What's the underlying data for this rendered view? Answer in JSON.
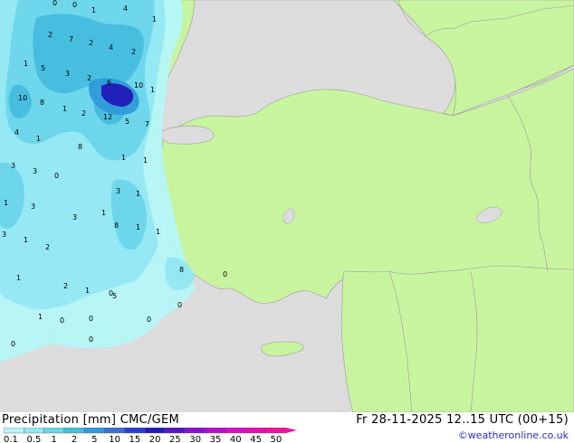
{
  "title": {
    "product": "Precipitation [mm]  CMC/GEM",
    "valid_time": "Fr 28-11-2025 12..15 UTC (00+15)"
  },
  "credit": "©weatheronline.co.uk",
  "legend": {
    "ticks": [
      "0.1",
      "0.5",
      "1",
      "2",
      "5",
      "10",
      "15",
      "20",
      "25",
      "30",
      "35",
      "40",
      "45",
      "50"
    ],
    "colors": [
      "#b5f5f8",
      "#93e8f3",
      "#6cd6ea",
      "#45bde0",
      "#2f9bd8",
      "#3a6fd4",
      "#2a3fd0",
      "#2219b8",
      "#5a12c8",
      "#8a10d0",
      "#b40fcc",
      "#d40fc4",
      "#e30fb0",
      "#f012a0"
    ]
  },
  "map": {
    "colors": {
      "sea": "#dcdcdc",
      "land": "#c8f4a0",
      "border": "#9a9a9a",
      "precip_light": "#b5f5f8",
      "precip_mid": "#93e8f3",
      "precip_heavy": "#6cd6ea",
      "precip_peak": "#2219b8"
    },
    "values": [
      {
        "t": "0"
      },
      {
        "t": "0"
      },
      {
        "t": "1"
      },
      {
        "t": "4"
      },
      {
        "t": "1"
      },
      {
        "t": "2"
      },
      {
        "t": "7"
      },
      {
        "t": "2"
      },
      {
        "t": "4"
      },
      {
        "t": "2"
      },
      {
        "t": "1"
      },
      {
        "t": "5"
      },
      {
        "t": "3"
      },
      {
        "t": "2"
      },
      {
        "t": "6"
      },
      {
        "t": "10"
      },
      {
        "t": "1"
      },
      {
        "t": "10"
      },
      {
        "t": "8"
      },
      {
        "t": "1"
      },
      {
        "t": "2"
      },
      {
        "t": "12"
      },
      {
        "t": "5"
      },
      {
        "t": "7"
      },
      {
        "t": "4"
      },
      {
        "t": "1"
      },
      {
        "t": "8"
      },
      {
        "t": "1"
      },
      {
        "t": "1"
      },
      {
        "t": "3"
      },
      {
        "t": "0"
      },
      {
        "t": "3"
      },
      {
        "t": "3"
      },
      {
        "t": "1"
      },
      {
        "t": "3"
      },
      {
        "t": "1"
      },
      {
        "t": "3"
      },
      {
        "t": "1"
      },
      {
        "t": "8"
      },
      {
        "t": "1"
      },
      {
        "t": "1"
      },
      {
        "t": "3"
      },
      {
        "t": "1"
      },
      {
        "t": "2"
      },
      {
        "t": "1"
      },
      {
        "t": "2"
      },
      {
        "t": "1"
      },
      {
        "t": "0"
      },
      {
        "t": "8"
      },
      {
        "t": "0"
      },
      {
        "t": "1"
      },
      {
        "t": "0"
      },
      {
        "t": "0"
      },
      {
        "t": "0"
      },
      {
        "t": "0"
      },
      {
        "t": "0"
      },
      {
        "t": "0"
      },
      {
        "t": "5"
      }
    ]
  }
}
